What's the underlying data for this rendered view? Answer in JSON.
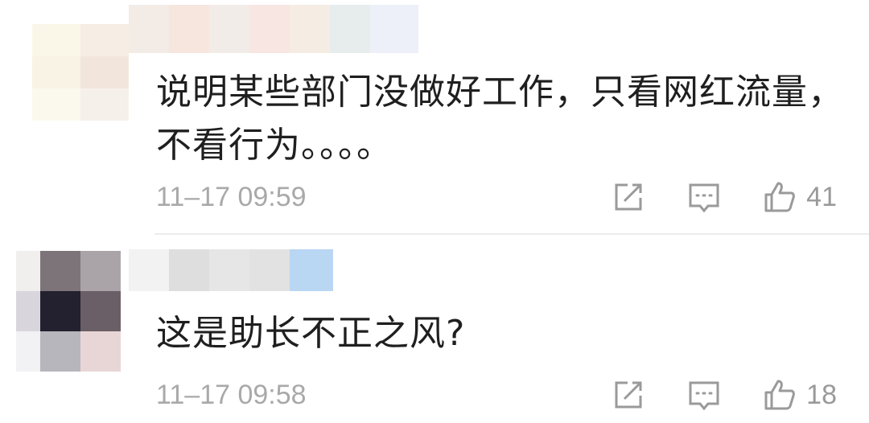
{
  "comments": [
    {
      "text": "说明某些部门没做好工作，只看网红流量，不看行为。。。。",
      "time": "11–17 09:59",
      "likes": "41",
      "icons": {
        "share": "share-icon",
        "reply": "reply-icon",
        "like": "thumbs-up-icon"
      }
    },
    {
      "text": "这是助长不正之风?",
      "time": "11–17 09:58",
      "likes": "18",
      "icons": {
        "share": "share-icon",
        "reply": "reply-icon",
        "like": "thumbs-up-icon"
      }
    }
  ],
  "colors": {
    "text": "#1f1f1f",
    "meta": "#a9a9a9",
    "icon": "#9a9a9a",
    "divider": "#ececec"
  }
}
